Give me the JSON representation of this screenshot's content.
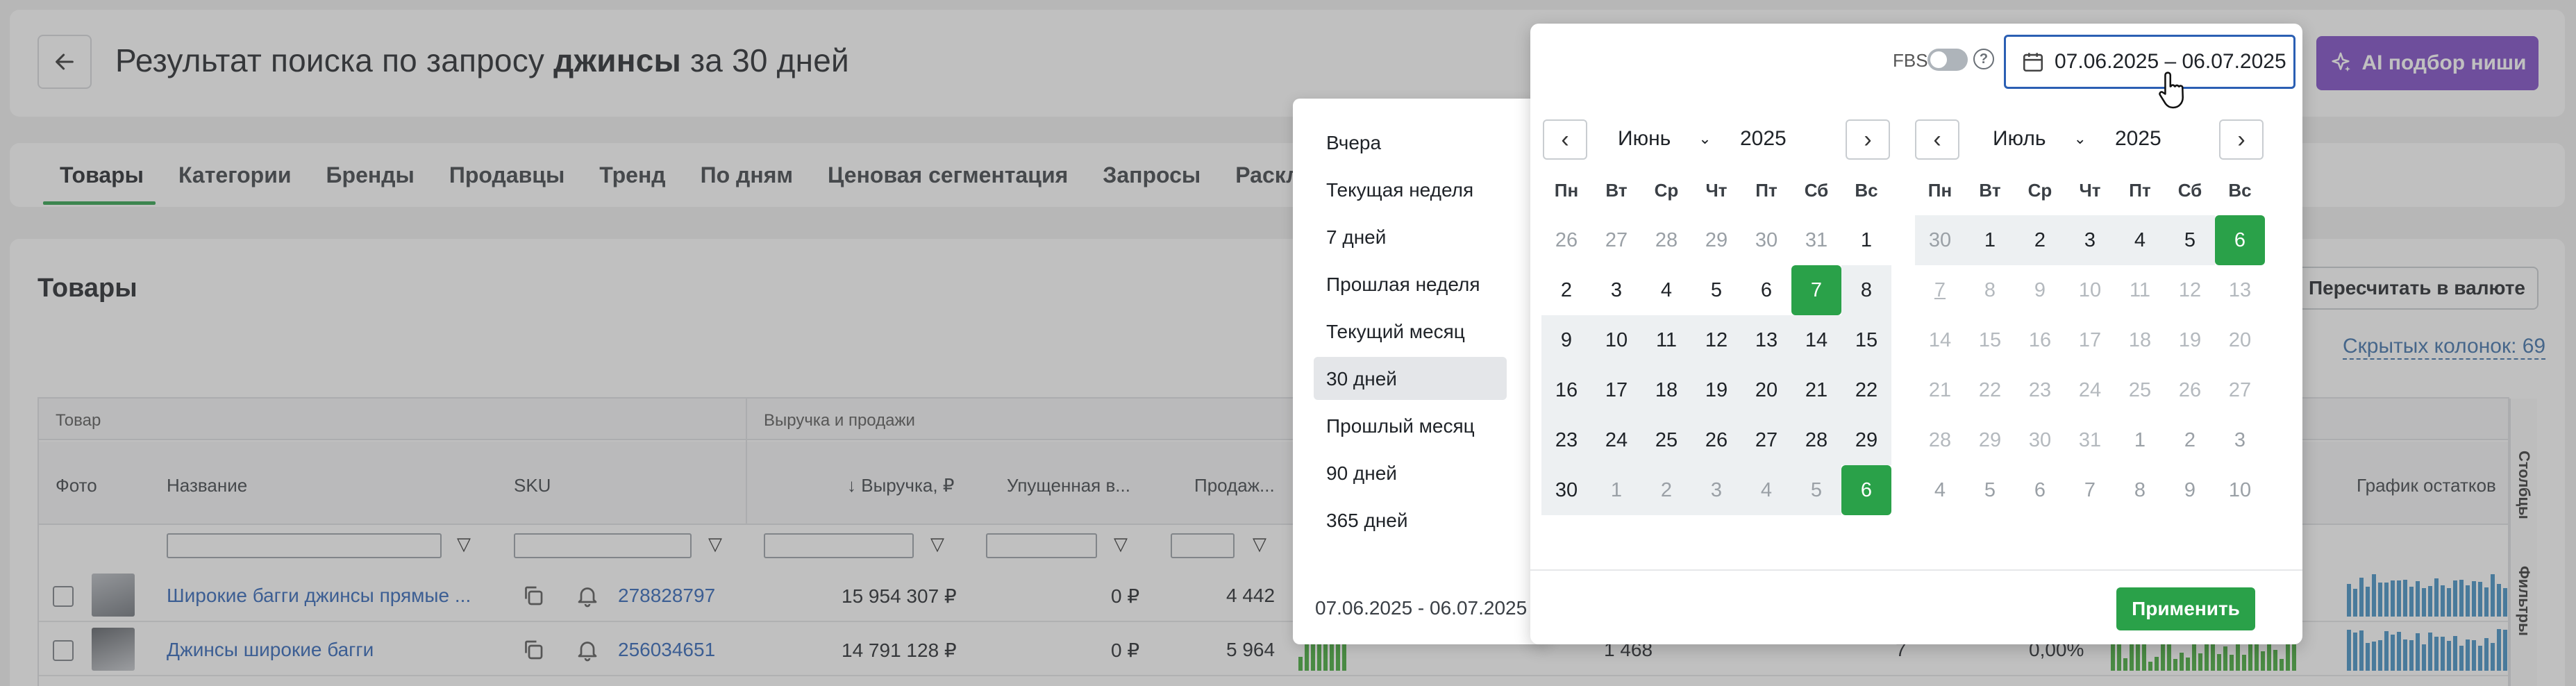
{
  "header": {
    "title_prefix": "Результат поиска по запросу ",
    "query": "джинсы",
    "title_suffix": " за 30 дней",
    "ai_button": "AI подбор ниши",
    "fbs_label": "FBS",
    "date_range": "07.06.2025 – 06.07.2025"
  },
  "tabs": [
    "Товары",
    "Категории",
    "Бренды",
    "Продавцы",
    "Тренд",
    "По дням",
    "Ценовая сегментация",
    "Запросы",
    "Раскладка"
  ],
  "products": {
    "title": "Товары",
    "recalc_button": "Пересчитать в валюте",
    "hidden_columns": "Скрытых колонок: 69"
  },
  "table": {
    "group_product": "Товар",
    "group_revenue": "Выручка и продажи",
    "col_photo": "Фото",
    "col_name": "Название",
    "col_sku": "SKU",
    "col_revenue": "↓ Выручка, ₽",
    "col_lost": "Упущенная в...",
    "col_sales": "Продаж...",
    "col_dots": "...",
    "col_stock_chart": "График остатков",
    "side_columns": "Столбцы",
    "side_filters": "Фильтры",
    "rows": [
      {
        "name": "Широкие багги джинсы прямые ...",
        "sku": "278828797",
        "revenue": "15 954 307 ₽",
        "lost": "0 ₽",
        "sales": "4 442"
      },
      {
        "name": "Джинсы широкие багги",
        "sku": "256034651",
        "revenue": "14 791 128 ₽",
        "lost": "0 ₽",
        "sales": "5 964",
        "extra1": "1 468",
        "extra2": "7",
        "extra3": "0,00%"
      }
    ]
  },
  "presets": {
    "items": [
      "Вчера",
      "Текущая неделя",
      "7 дней",
      "Прошлая неделя",
      "Текущий месяц",
      "30 дней",
      "Прошлый месяц",
      "90 дней",
      "365 дней"
    ],
    "selected": "30 дней",
    "footer_range": "07.06.2025 - 06.07.2025"
  },
  "calendar": {
    "weekdays": [
      "Пн",
      "Вт",
      "Ср",
      "Чт",
      "Пт",
      "Сб",
      "Вс"
    ],
    "left": {
      "month": "Июнь",
      "year": "2025"
    },
    "right": {
      "month": "Июль",
      "year": "2025"
    },
    "apply": "Применить"
  },
  "colors": {
    "accent_green": "#2aa149",
    "accent_purple": "#7b47c6",
    "link_blue": "#2b62b6"
  }
}
